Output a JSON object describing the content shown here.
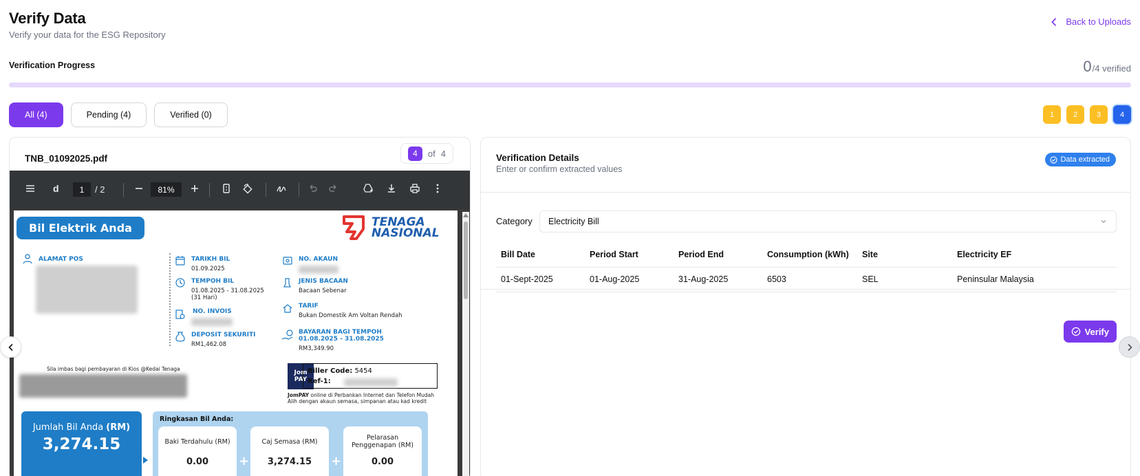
{
  "header": {
    "title": "Verify Data",
    "subtitle": "Verify your data for the ESG Repository",
    "back_label": "Back to Uploads"
  },
  "progress": {
    "label": "Verification Progress",
    "verified_count": "0",
    "total_label": "/4 verified",
    "fraction": 0
  },
  "filters": [
    {
      "label": "All (4)",
      "active": true
    },
    {
      "label": "Pending (4)",
      "active": false
    },
    {
      "label": "Verified (0)",
      "active": false
    }
  ],
  "page_chips": [
    "1",
    "2",
    "3",
    "4"
  ],
  "current_chip": "4",
  "colors": {
    "accent": "#7c3aed",
    "chip_pending": "#fbbf24",
    "chip_current": "#2563eb",
    "badge": "#2f80ed"
  },
  "document": {
    "file_name": "TNB_01092025.pdf",
    "current": "4",
    "of_label": "of",
    "total": "4"
  },
  "viewer": {
    "doc_initial": "d",
    "page_current": "1",
    "page_total": "/ 2",
    "zoom": "81%"
  },
  "bill": {
    "title": "Bil Elektrik Anda",
    "brand_line1": "TENAGA",
    "brand_line2": "NASIONAL",
    "alamat_label": "ALAMAT POS",
    "tarikh_label": "TARIKH BIL",
    "tarikh_value": "01.09.2025",
    "tempoh_label": "TEMPOH BIL",
    "tempoh_value": "01.08.2025 - 31.08.2025",
    "tempoh_days": "(31 Hari)",
    "invois_label": "NO. INVOIS",
    "deposit_label": "DEPOSIT SEKURITI",
    "deposit_value": "RM1,462.08",
    "akaun_label": "NO. AKAUN",
    "bacaan_label": "JENIS BACAAN",
    "bacaan_value": "Bacaan Sebenar",
    "tarif_label": "TARIF",
    "tarif_value": "Bukan Domestik Am Voltan Rendah",
    "bayaran_label": "BAYARAN BAGI TEMPOH",
    "bayaran_period": "01.08.2025 - 31.08.2025",
    "bayaran_value": "RM3,349.90",
    "imbas_note": "Sila imbas bagi pembayaran di Kios @Kedai Tenaga",
    "jompay_label": "Jom PAY",
    "biller_code_label": "Biller Code:",
    "biller_code": "5454",
    "ref_label": "Ref-1:",
    "jompay_note_bold": "JomPAY",
    "jompay_note1": "online di Perbankan Internet dan Telefon Mudah",
    "jompay_note2": "Alih dengan akaun semasa, simpanan atau kad kredit",
    "jumlah_label": "Jumlah Bil Anda",
    "jumlah_unit": "(RM)",
    "jumlah_value": "3,274.15",
    "ringkasan_title": "Ringkasan Bil Anda:",
    "baki_label": "Baki Terdahulu (RM)",
    "baki_value": "0.00",
    "caj_label": "Caj Semasa (RM)",
    "caj_value": "3,274.15",
    "pelarasan_label1": "Pelarasan",
    "pelarasan_label2": "Penggenapan (RM)",
    "pelarasan_value": "0.00"
  },
  "details": {
    "title": "Verification Details",
    "subtitle": "Enter or confirm extracted values",
    "badge": "Data extracted",
    "category_label": "Category",
    "category_value": "Electricity Bill",
    "columns": [
      "Bill Date",
      "Period Start",
      "Period End",
      "Consumption (kWh)",
      "Site",
      "Electricity EF"
    ],
    "rows": [
      [
        "01-Sept-2025",
        "01-Aug-2025",
        "31-Aug-2025",
        "6503",
        "SEL",
        "Peninsular Malaysia"
      ]
    ],
    "verify_label": "Verify"
  }
}
